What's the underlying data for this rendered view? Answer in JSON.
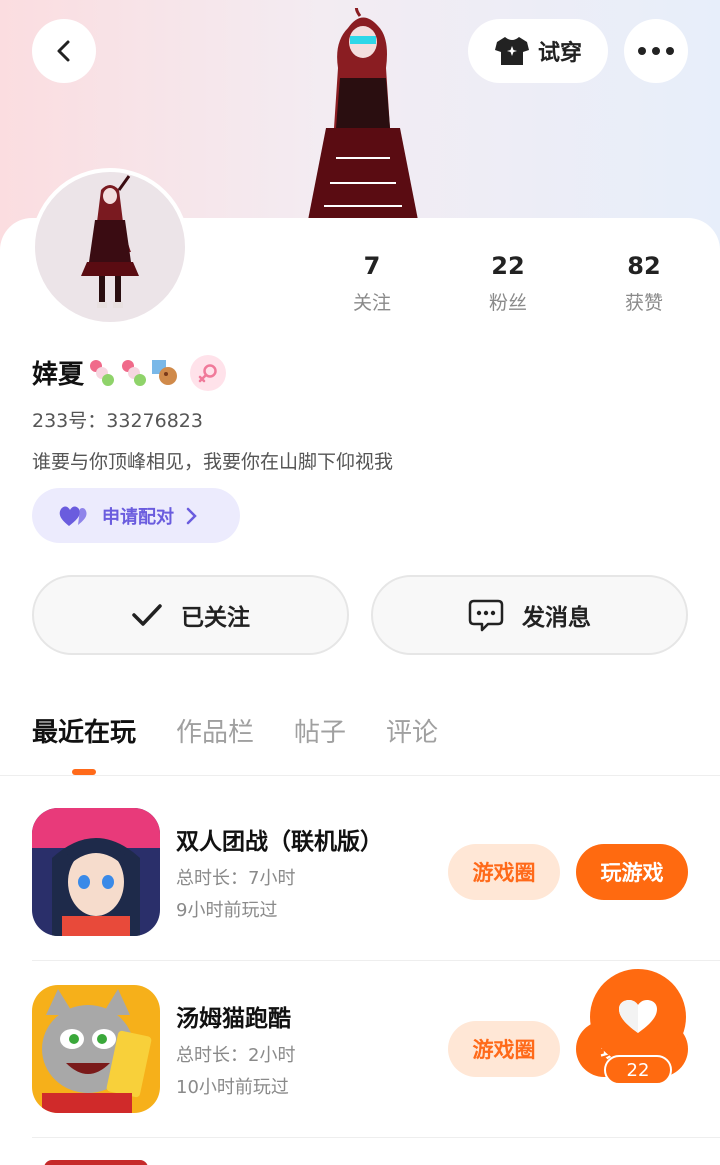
{
  "header": {
    "tryon_label": "试穿"
  },
  "profile": {
    "name": "婞夏",
    "uid": "233号：33276823",
    "bio": "谁要与你顶峰相见，我要你在山脚下仰视我",
    "pair_label": "申请配对",
    "stats": [
      {
        "value": "7",
        "label": "关注"
      },
      {
        "value": "22",
        "label": "粉丝"
      },
      {
        "value": "82",
        "label": "获赞"
      }
    ]
  },
  "actions": {
    "follow_label": "已关注",
    "message_label": "发消息"
  },
  "tabs": [
    "最近在玩",
    "作品栏",
    "帖子",
    "评论"
  ],
  "games": [
    {
      "title": "双人团战（联机版）",
      "duration": "总时长：7小时",
      "last_played": "9小时前玩过",
      "circle_label": "游戏圈",
      "play_label": "玩游戏"
    },
    {
      "title": "汤姆猫跑酷",
      "duration": "总时长：2小时",
      "last_played": "10小时前玩过",
      "circle_label": "游戏圈",
      "play_label": "玩游戏"
    }
  ],
  "like_fab": {
    "count": "22"
  },
  "colors": {
    "accent": "#ff6a10",
    "pair": "#6a5cde"
  }
}
